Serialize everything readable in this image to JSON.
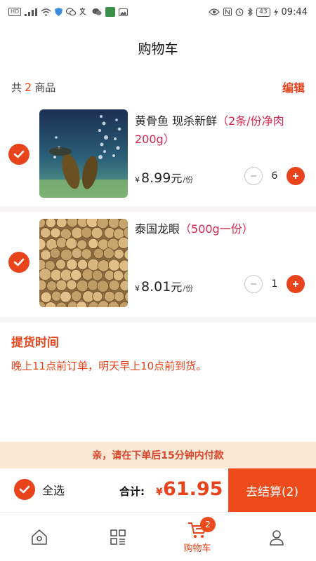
{
  "status_bar": {
    "left_icons": [
      "hd-icon",
      "4g-signal-icon",
      "wifi-icon",
      "shield-icon",
      "wechat-icon",
      "translate-icon",
      "chat-icon",
      "app-icon",
      "image-icon"
    ],
    "hd_label": "HD",
    "battery": "43",
    "time": "09:44"
  },
  "header": {
    "title": "购物车"
  },
  "summary": {
    "prefix": "共",
    "count": "2",
    "suffix": "商品",
    "edit_label": "编辑"
  },
  "cart": {
    "items": [
      {
        "name": "黄骨鱼 现杀新鲜",
        "spec": "（2条/份净肉200g）",
        "yen": "¥",
        "price": "8.99",
        "unit": "元",
        "per": "/份",
        "quantity": "6",
        "selected": true
      },
      {
        "name": "泰国龙眼",
        "spec": "（500g一份）",
        "yen": "¥",
        "price": "8.01",
        "unit": "元",
        "per": "/份",
        "quantity": "1",
        "selected": true
      }
    ]
  },
  "pickup": {
    "title": "提货时间",
    "text": "晚上11点前订单，明天早上10点前到货。"
  },
  "notice": {
    "text": "亲，请在下单后15分钟内付款"
  },
  "checkout": {
    "select_all_label": "全选",
    "total_label": "合计:",
    "currency": "¥",
    "total": "61.95",
    "button_label": "去结算(2)"
  },
  "tabbar": {
    "tabs": [
      {
        "icon": "home-icon",
        "label": ""
      },
      {
        "icon": "category-icon",
        "label": ""
      },
      {
        "icon": "cart-icon",
        "label": "购物车",
        "badge": "2",
        "active": true
      },
      {
        "icon": "profile-icon",
        "label": ""
      }
    ]
  },
  "colors": {
    "accent": "#e8431b",
    "spec_text": "#d9264f",
    "notice_bg": "#fbe9d6"
  }
}
